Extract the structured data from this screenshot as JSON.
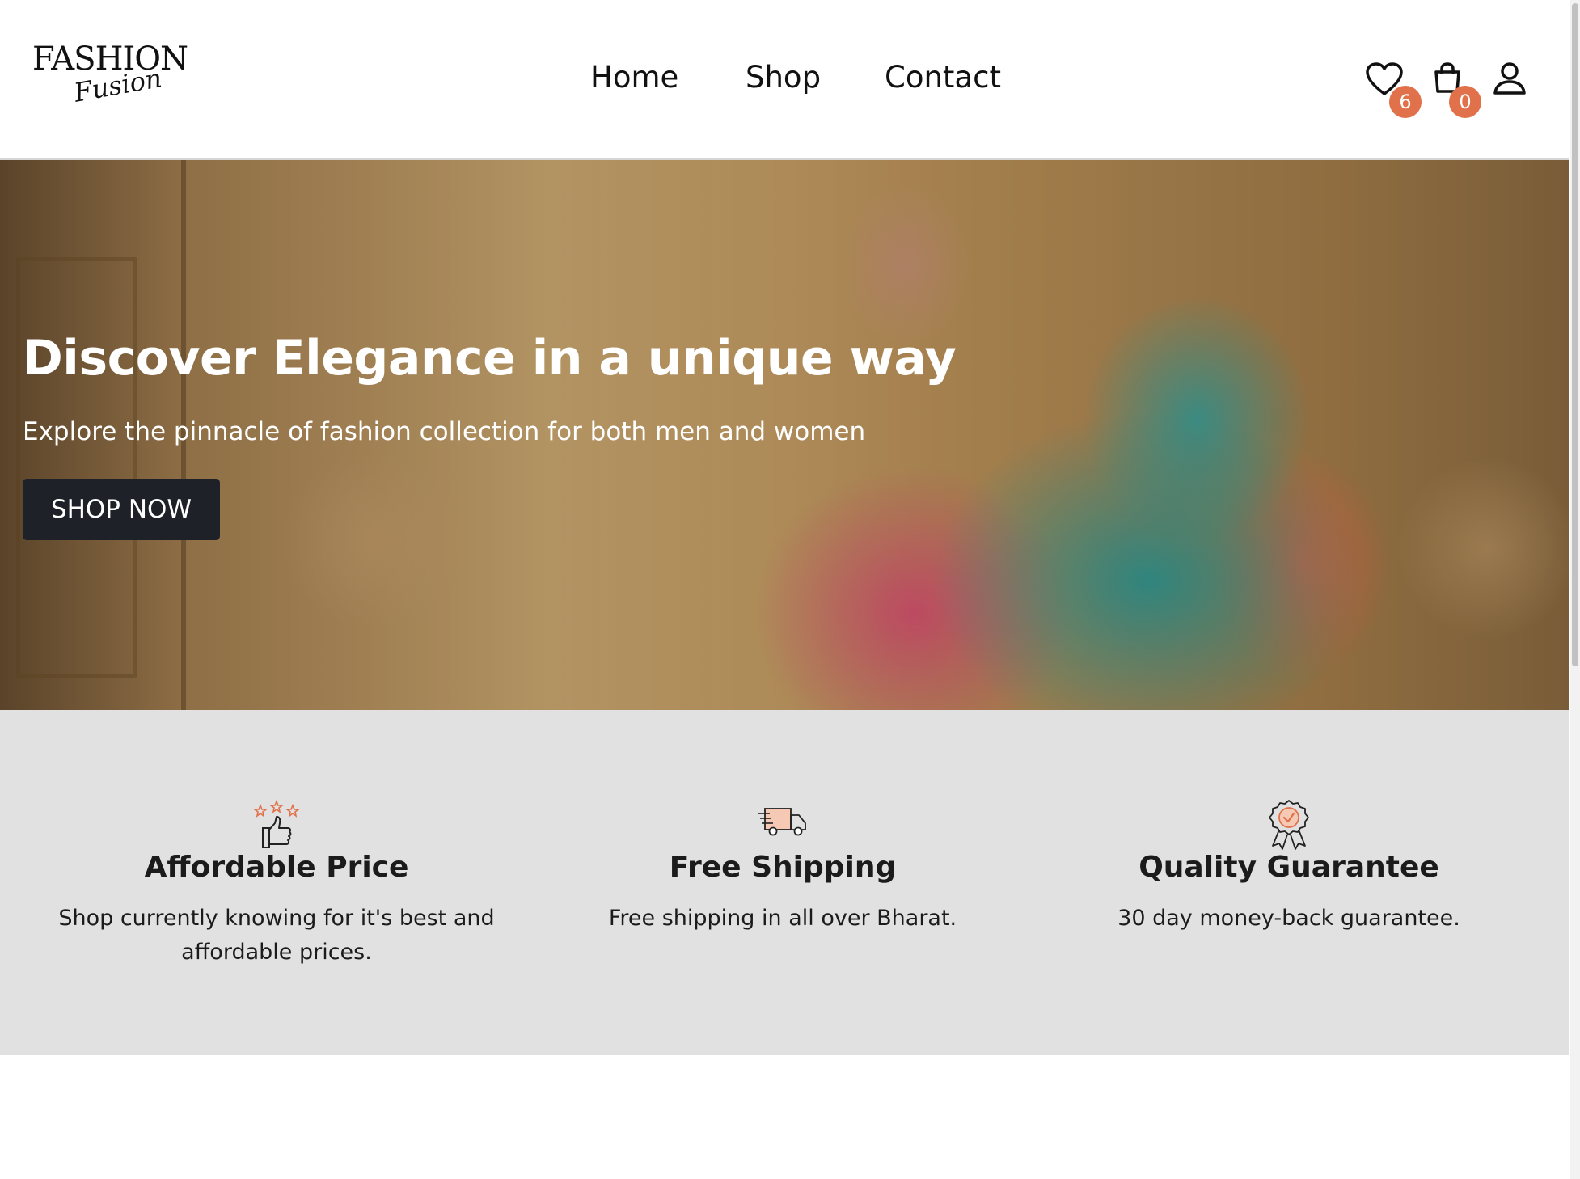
{
  "brand": {
    "name": "FASHION",
    "tagline": "Fusion"
  },
  "nav": [
    {
      "label": "Home"
    },
    {
      "label": "Shop"
    },
    {
      "label": "Contact"
    }
  ],
  "header_icons": {
    "wishlist": {
      "icon": "heart-icon",
      "count": "6"
    },
    "cart": {
      "icon": "shopping-bag-icon",
      "count": "0"
    },
    "account": {
      "icon": "user-icon"
    },
    "badge_color": "#e1714a"
  },
  "hero": {
    "title": "Discover Elegance in a unique way",
    "subtitle": "Explore the pinnacle of fashion collection for both men and women",
    "cta_label": "SHOP NOW",
    "cta_color": "#1e2228"
  },
  "features": [
    {
      "icon": "thumbs-up-stars-icon",
      "title": "Affordable Price",
      "text": "Shop currently knowing for it's best and affordable prices."
    },
    {
      "icon": "delivery-truck-icon",
      "title": "Free Shipping",
      "text": "Free shipping in all over Bharat."
    },
    {
      "icon": "quality-badge-icon",
      "title": "Quality Guarantee",
      "text": "30 day money-back guarantee."
    }
  ],
  "colors": {
    "accent": "#e1714a",
    "features_bg": "#e1e1e1",
    "text": "#111111"
  }
}
